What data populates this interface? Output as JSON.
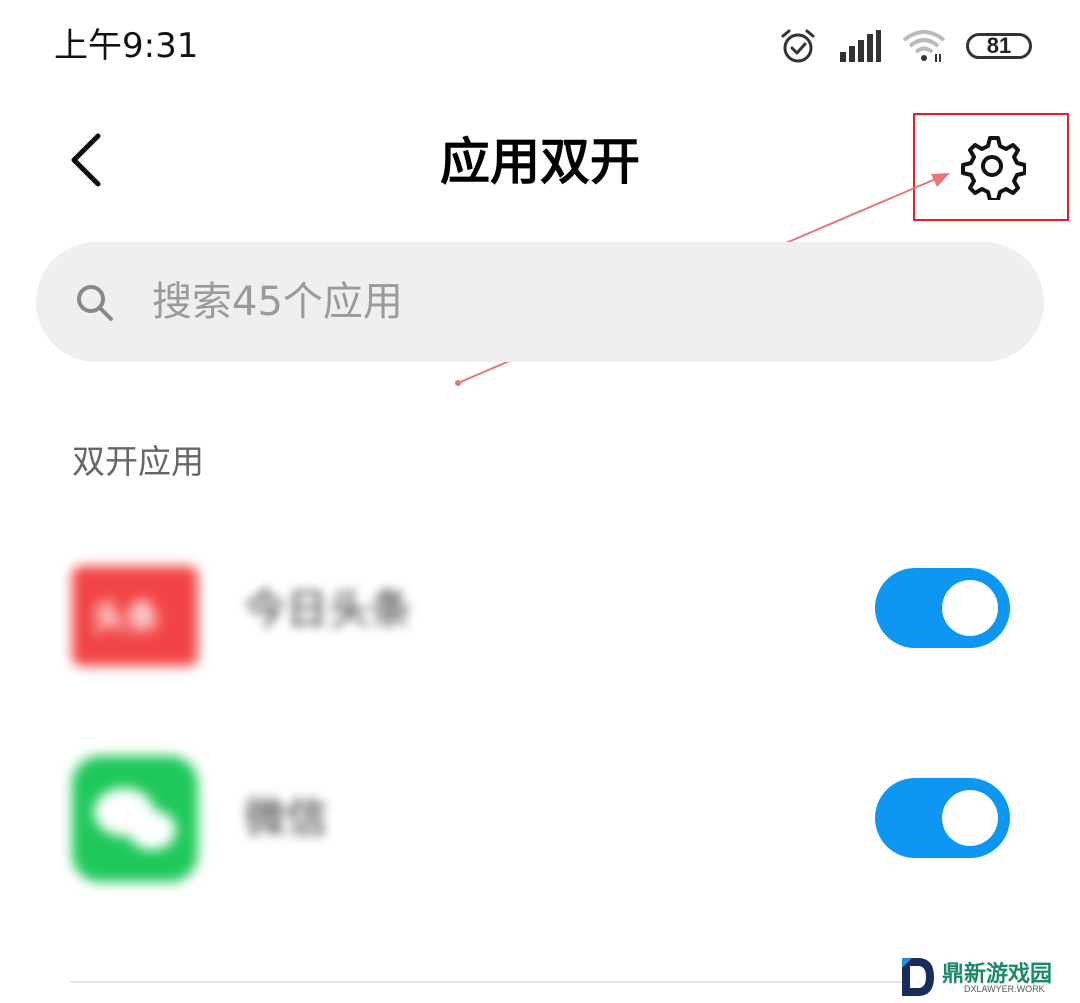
{
  "status_bar": {
    "time": "上午9:31",
    "battery": "81"
  },
  "header": {
    "title": "应用双开"
  },
  "search": {
    "placeholder": "搜索45个应用"
  },
  "section": {
    "title": "双开应用"
  },
  "apps": [
    {
      "name": "今日头条",
      "icon_label": "头条",
      "icon": "toutiao-icon",
      "enabled": true
    },
    {
      "name": "微信",
      "icon": "wechat-icon",
      "enabled": true
    }
  ],
  "colors": {
    "toggle_on": "#0d96f2",
    "highlight": "#e02424",
    "search_bg": "#efefef"
  },
  "watermark": {
    "text": "鼎新游戏园",
    "sub": "DXLAWYER.WORK"
  }
}
